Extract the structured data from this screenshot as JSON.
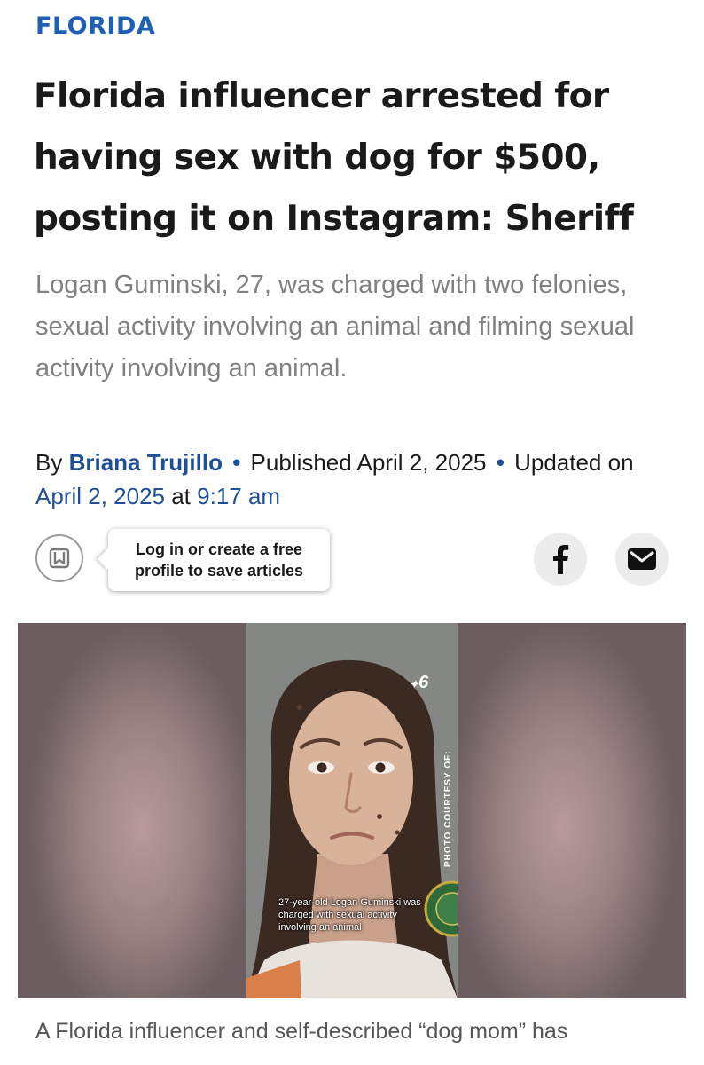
{
  "section": {
    "label": "FLORIDA"
  },
  "article": {
    "headline": "Florida influencer arrested for having sex with dog for $500, posting it on Instagram: Sheriff",
    "dek": "Logan Guminski, 27, was charged with two felonies, sexual activity involving an animal and filming sexual activity involving an animal.",
    "byline": {
      "by": "By",
      "author": "Briana Trujillo",
      "separator": "•",
      "published_label": "Published April 2, 2025",
      "updated_label": "Updated",
      "on_label": "on",
      "updated_date": "April 2, 2025",
      "at_label": "at",
      "updated_time": "9:17 am"
    },
    "save_prompt": "Log in or create a free profile to save articles",
    "photo": {
      "caption": "27-year-old Logan Guminski was charged with sexual activity involving an animal",
      "credit": "PHOTO COURTESY OF:",
      "station_logo": "6"
    },
    "body_first_line": "A Florida influencer and self-described “dog mom” has"
  },
  "icons": {
    "bookmark": "bookmark-icon",
    "facebook": "facebook-icon",
    "email": "email-icon",
    "station": "nbc-peacock-icon"
  },
  "colors": {
    "section": "#1f5fb4",
    "author_link": "#1f4f96",
    "dek_gray": "#808080",
    "share_bg": "#ececec"
  }
}
